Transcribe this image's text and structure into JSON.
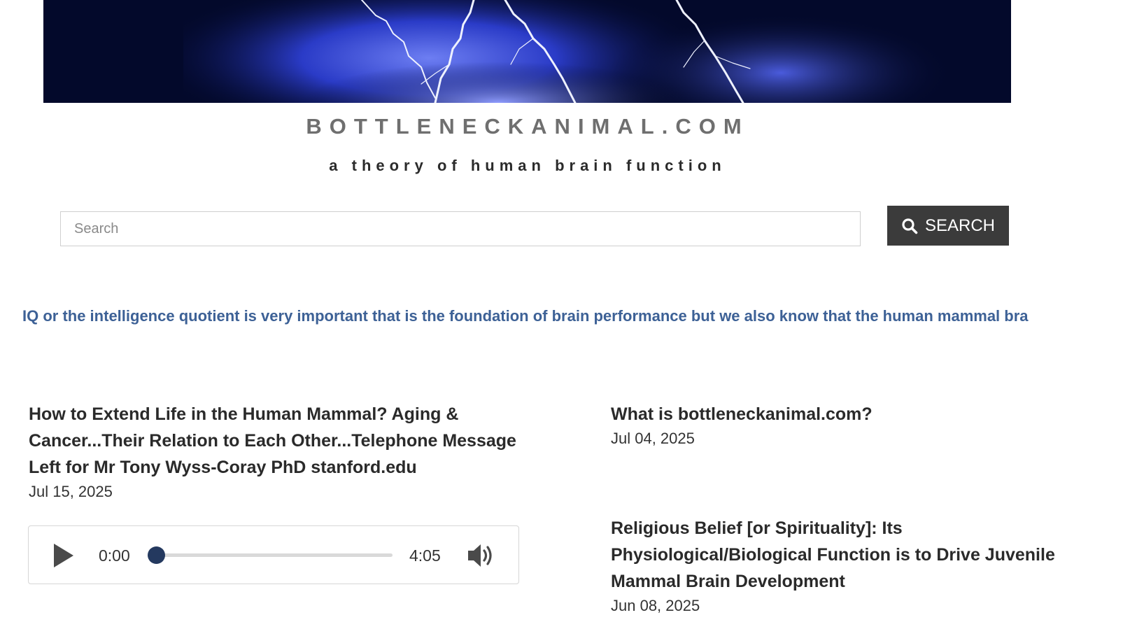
{
  "header": {
    "site_title": "BOTTLENECKANIMAL.COM",
    "tagline": "a theory of human brain function"
  },
  "search": {
    "placeholder": "Search",
    "value": "",
    "button_label": "SEARCH"
  },
  "ticker": {
    "text": "IQ or the intelligence quotient is very important that is the foundation of brain performance but we also know that the human mammal bra"
  },
  "posts": [
    {
      "title": "How to Extend Life in the Human Mammal? Aging & Cancer...Their Relation to Each Other...Telephone Message Left for Mr Tony Wyss-Coray PhD stanford.edu",
      "date": "Jul 15, 2025"
    },
    {
      "title": "What is bottleneckanimal.com?",
      "date": "Jul 04, 2025"
    },
    {
      "title": "Religious Belief [or Spirituality]: Its Physiological/Biological Function is to Drive Juvenile Mammal Brain Development",
      "date": "Jun 08, 2025"
    }
  ],
  "audio": {
    "current_time": "0:00",
    "duration": "4:05",
    "progress": 0
  },
  "icons": {
    "search": "search-icon",
    "play": "play-icon",
    "volume": "volume-icon"
  },
  "colors": {
    "banner_bg": "#03092b",
    "lightning": "#e8ecff",
    "search_button_bg": "#3b3b3b",
    "ticker_text": "#3d6196",
    "player_accent": "#24395f"
  }
}
